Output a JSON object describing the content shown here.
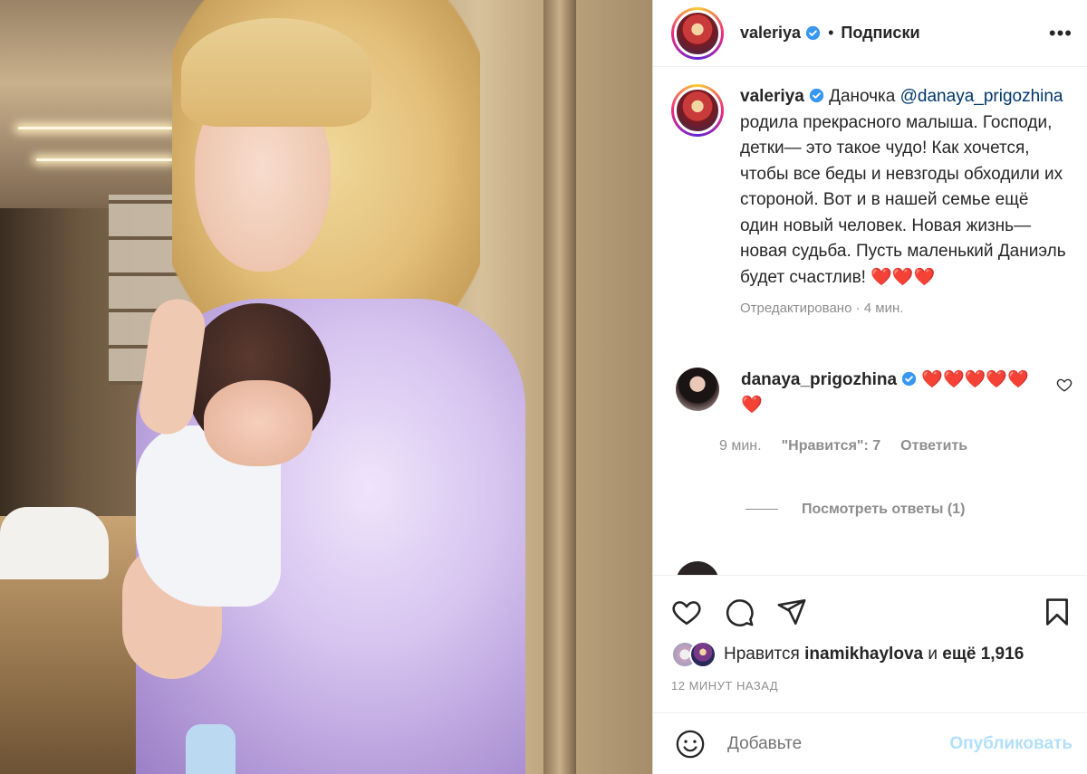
{
  "header": {
    "username": "valeriya",
    "separator": "•",
    "follow_label": "Подписки",
    "more_label": "•••"
  },
  "caption": {
    "username": "valeriya",
    "text_before": "Даночка ",
    "mention": "@danaya_prigozhina",
    "text_after": " родила прекрасного малыша. Господи, детки— это такое чудо! Как хочется, чтобы все беды и невзгоды обходили их стороной. Вот и в нашей семье ещё один новый человек. Новая жизнь— новая судьба. Пусть маленький Даниэль будет счастлив! ❤️❤️❤️",
    "edited": "Отредактировано",
    "time": "4 мин."
  },
  "comment": {
    "username": "danaya_prigozhina",
    "text": "❤️❤️❤️❤️❤️❤️",
    "time": "9 мин.",
    "likes": "\"Нравится\": 7",
    "reply_label": "Ответить",
    "view_replies": "Посмотреть ответы (1)"
  },
  "likes_bar": {
    "prefix": "Нравится",
    "liker": "inamikhaylova",
    "middle": "и",
    "others": "ещё 1,916",
    "timestamp": "12 МИНУТ НАЗАД"
  },
  "composer": {
    "placeholder": "Добавьте",
    "publish_label": "Опубликовать"
  },
  "colors": {
    "verified": "#3897f0",
    "link": "#00376b",
    "muted": "#8e8e8e",
    "publish_disabled": "#b2dffc"
  }
}
